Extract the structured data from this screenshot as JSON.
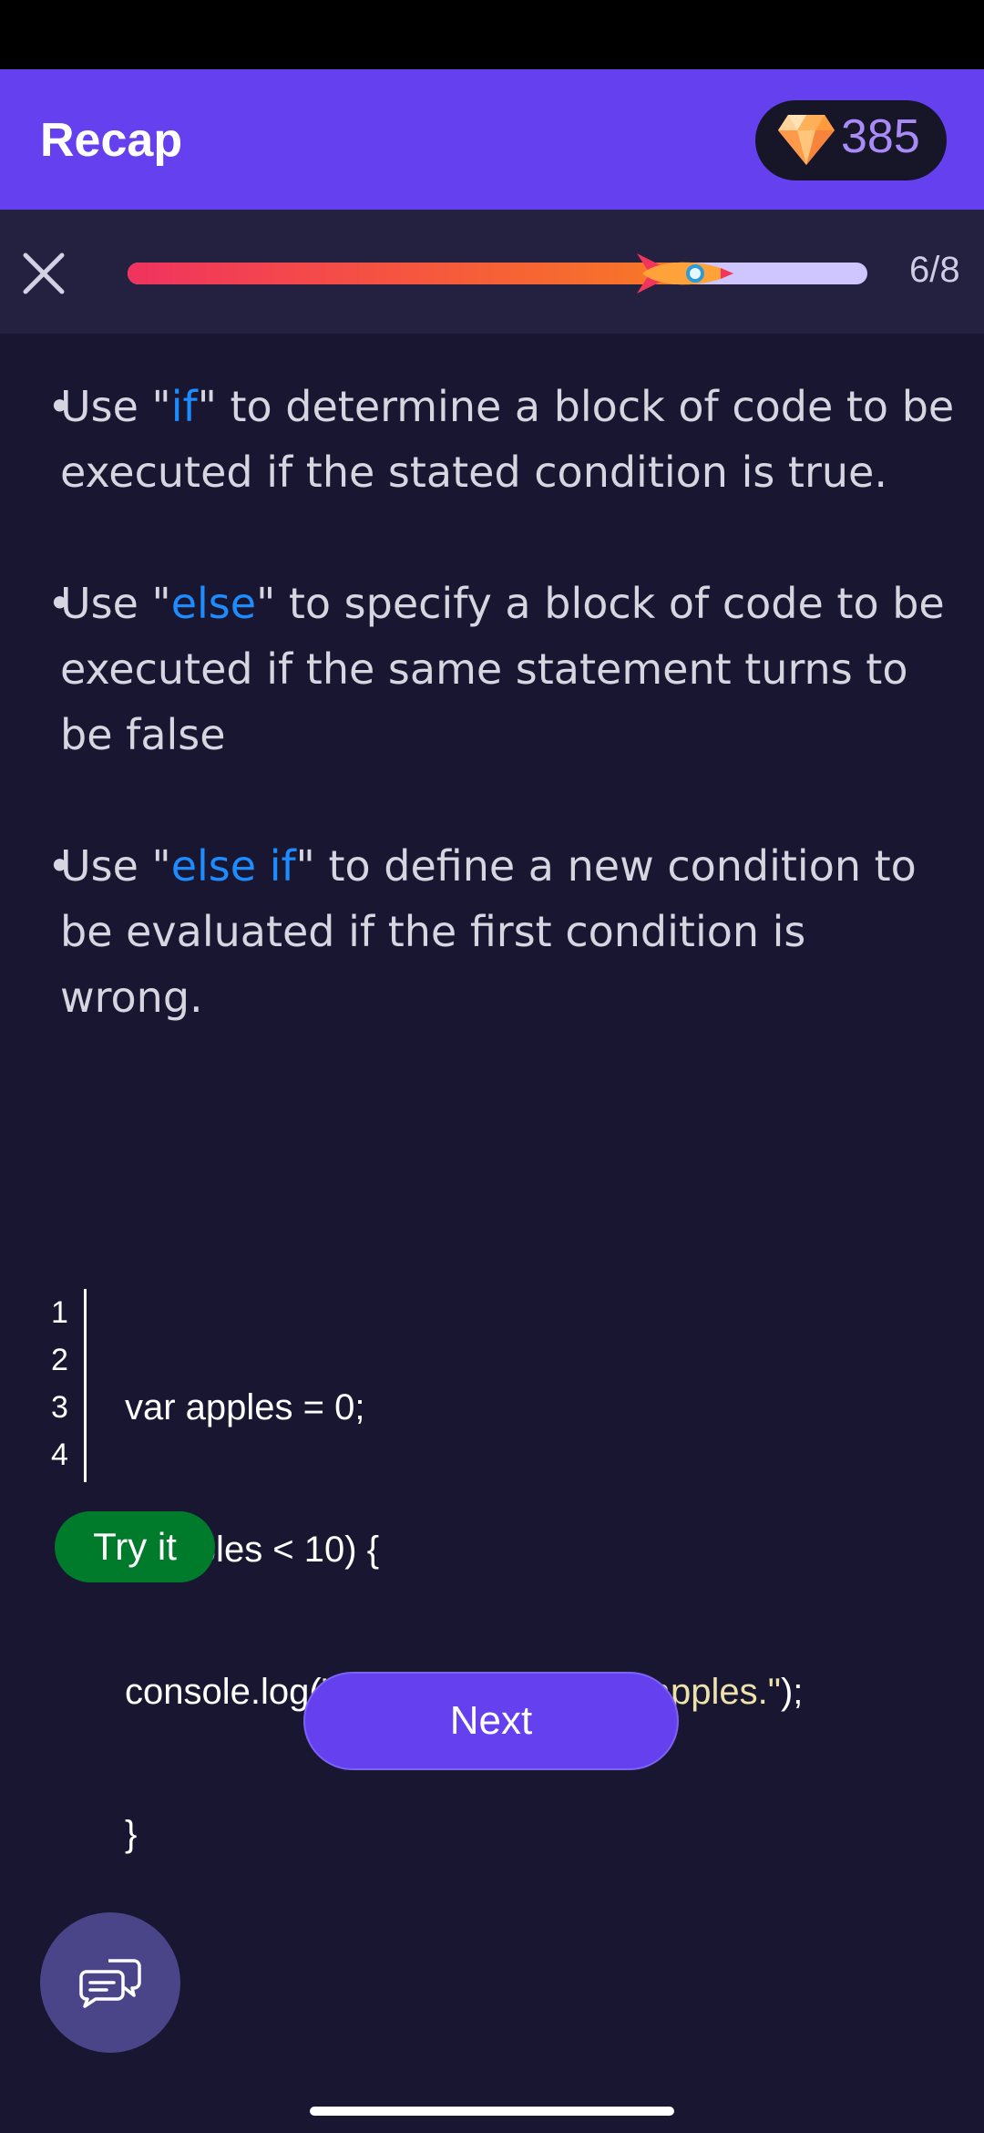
{
  "header": {
    "title": "Recap",
    "gem_count": "385"
  },
  "lesson": {
    "progress_label": "6/8",
    "progress_fraction": 0.75
  },
  "recap": {
    "items": [
      {
        "dot": "•",
        "pre": "Use \"",
        "keyword": "if",
        "post": "\" to determine a block of code to be executed if the stated condition is true."
      },
      {
        "dot": "•",
        "pre": "Use \"",
        "keyword": "else",
        "post": "\" to specify a block of code to be executed if the same statement turns to be false"
      },
      {
        "dot": "•",
        "pre": "Use \"",
        "keyword": "else if",
        "post": "\" to define a new condition to be evaluated if the first condition is wrong."
      }
    ]
  },
  "code": {
    "line_numbers": [
      "1",
      "2",
      "3",
      "4"
    ],
    "lines": [
      {
        "text": "var apples = 0;"
      },
      {
        "text": "if(apples < 10) {"
      },
      {
        "pre": "console.log(",
        "string": "\"I have less than 10 apples.\"",
        "post": ");"
      },
      {
        "text": "}"
      }
    ]
  },
  "buttons": {
    "try_label": "Try it",
    "next_label": "Next"
  },
  "colors": {
    "header": "#6440ef",
    "background": "#181631",
    "keyword": "#1d8cff",
    "try_button": "#007b2b",
    "progress_start": "#f0335f",
    "progress_end": "#f77925"
  },
  "icons": {
    "close": "close-icon",
    "gem": "diamond-icon",
    "progress_marker": "rocket-icon",
    "chat": "chat-bubbles-icon"
  }
}
